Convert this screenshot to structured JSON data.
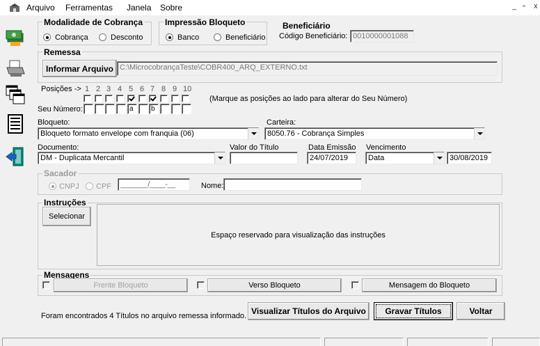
{
  "menu": {
    "items": [
      "Arquivo",
      "Ferramentas",
      "Janela",
      "Sobre"
    ],
    "window_controls": [
      "_",
      "▫",
      "x"
    ]
  },
  "toolbar": {
    "icons": [
      "money-icon",
      "printer-icon",
      "windows-icon",
      "document-icon",
      "exit-icon"
    ]
  },
  "modalidade": {
    "title": "Modalidade de Cobrança",
    "options": [
      "Cobrança",
      "Desconto"
    ],
    "selected": "Cobrança"
  },
  "impressao": {
    "title": "Impressão Bloqueto",
    "options": [
      "Banco",
      "Beneficiário"
    ],
    "selected": "Banco"
  },
  "beneficiario": {
    "title": "Beneficiário",
    "codigo_label": "Código Beneficiário:",
    "codigo_value": "0010000001088"
  },
  "remessa": {
    "title": "Remessa",
    "button": "Informar Arquivo",
    "path": "C:\\MicrocobrançaTeste\\COBR400_ARQ_EXTERNO.txt"
  },
  "posicoes": {
    "label": "Posições ->",
    "numbers": [
      "1",
      "2",
      "3",
      "4",
      "5",
      "6",
      "7",
      "8",
      "9",
      "10"
    ],
    "checked": [
      false,
      false,
      false,
      false,
      true,
      false,
      true,
      false,
      false,
      false
    ],
    "hint": "(Marque as posições ao lado para alterar do Seu Número)",
    "seu_numero_label": "Seu Número:",
    "seu_numero_values": [
      "",
      "",
      "",
      "",
      "a",
      "",
      "b",
      "",
      "",
      ""
    ]
  },
  "bloqueto": {
    "label": "Bloqueto:",
    "value": "Bloqueto formato envelope com franquia (06)"
  },
  "carteira": {
    "label": "Carteira:",
    "value": "8050.76 - Cobrança Simples"
  },
  "documento": {
    "label": "Documento:",
    "value": "DM - Duplicata Mercantil"
  },
  "valor_titulo": {
    "label": "Valor do Título",
    "value": ""
  },
  "data_emissao": {
    "label": "Data Emissão",
    "value": "24/07/2019"
  },
  "vencimento": {
    "label": "Vencimento",
    "type": "Data",
    "value": "30/08/2019"
  },
  "sacador": {
    "title": "Sacador",
    "options": [
      "CNPJ",
      "CPF"
    ],
    "selected": "CNPJ",
    "doc_mask": "_______/____-__",
    "nome_label": "Nome:",
    "nome_value": ""
  },
  "instrucoes": {
    "title": "Instruções",
    "button": "Selecionar",
    "placeholder": "Espaço reservado para visualização das instruções"
  },
  "mensagens": {
    "title": "Mensagens",
    "buttons": [
      "Frente Bloqueto",
      "Verso Bloqueto",
      "Mensagem do Bloqueto"
    ]
  },
  "footer": {
    "info": "Foram encontrados 4 Títulos no arquivo remessa informado.",
    "visualizar": "Visualizar Títulos do Arquivo",
    "gravar": "Gravar Títulos",
    "voltar": "Voltar"
  }
}
